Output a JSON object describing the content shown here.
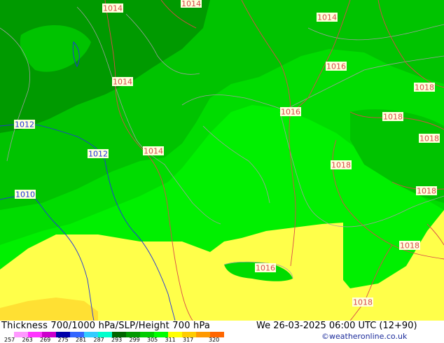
{
  "map": {
    "isobars": [
      {
        "label": "1014",
        "color": "#d94a4a"
      },
      {
        "label": "1014",
        "color": "#d94a4a"
      },
      {
        "label": "1014",
        "color": "#d94a4a"
      },
      {
        "label": "1016",
        "color": "#d94a4a"
      },
      {
        "label": "1018",
        "color": "#d94a4a"
      },
      {
        "label": "1012",
        "color": "#2233dd"
      },
      {
        "label": "1014",
        "color": "#d94a4a"
      },
      {
        "label": "1016",
        "color": "#d94a4a"
      },
      {
        "label": "1018",
        "color": "#d94a4a"
      },
      {
        "label": "1018",
        "color": "#d94a4a"
      },
      {
        "label": "1012",
        "color": "#2233dd"
      },
      {
        "label": "1014",
        "color": "#d94a4a"
      },
      {
        "label": "1018",
        "color": "#d94a4a"
      },
      {
        "label": "1010",
        "color": "#2233dd"
      },
      {
        "label": "1018",
        "color": "#d94a4a"
      },
      {
        "label": "1018",
        "color": "#d94a4a"
      },
      {
        "label": "1016",
        "color": "#d94a4a"
      },
      {
        "label": "1018",
        "color": "#d94a4a"
      }
    ],
    "colors": {
      "dark_green": "#009a00",
      "mid_green": "#00c300",
      "green": "#00dc00",
      "light_green": "#00f000",
      "yellow": "#ffff4a",
      "deep_yellow": "#ffe033",
      "coast": "#a0a0a0",
      "high_isobar": "#d94a4a",
      "low_isobar": "#2233dd"
    }
  },
  "footer": {
    "title": "Thickness 700/1000 hPa/SLP/Height 700 hPa",
    "datetime": "We 26-03-2025 06:00 UTC (12+90)",
    "credit": "©weatheronline.co.uk",
    "legend_colors": [
      "#ff99ff",
      "#ff33ff",
      "#cc00cc",
      "#0000aa",
      "#3366ff",
      "#33ccff",
      "#00ffcc",
      "#006600",
      "#009900",
      "#00cc00",
      "#00ff00",
      "#ffff00",
      "#ffcc00",
      "#ff9900",
      "#ff6600"
    ],
    "legend_ticks": [
      "257",
      "263",
      "269",
      "275",
      "281",
      "287",
      "293",
      "299",
      "305",
      "311",
      "317",
      "320"
    ]
  }
}
